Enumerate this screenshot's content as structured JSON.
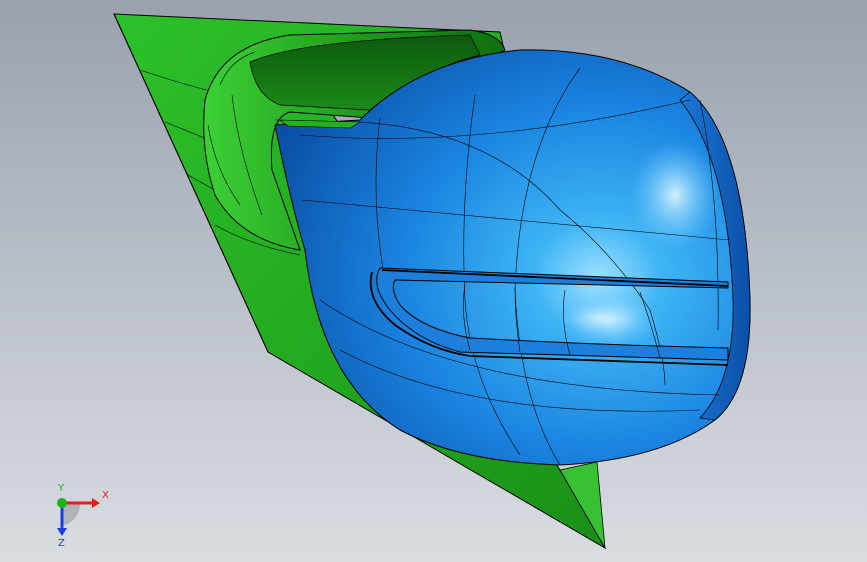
{
  "viewport": {
    "background_top": "#9aa1ad",
    "background_bottom": "#d9dde2"
  },
  "model": {
    "housing_color": "#1e8ce6",
    "housing_highlight": "#8fd8ff",
    "housing_shadow": "#0b4fb0",
    "base_plate_color": "#22b020",
    "base_plate_dark": "#0b6e0b",
    "edge_color": "#000000"
  },
  "triad": {
    "x_label": "X",
    "y_label": "Y",
    "z_label": "Z",
    "x_color": "#e81c1c",
    "y_color": "#18b418",
    "z_color": "#1c3ce8"
  }
}
